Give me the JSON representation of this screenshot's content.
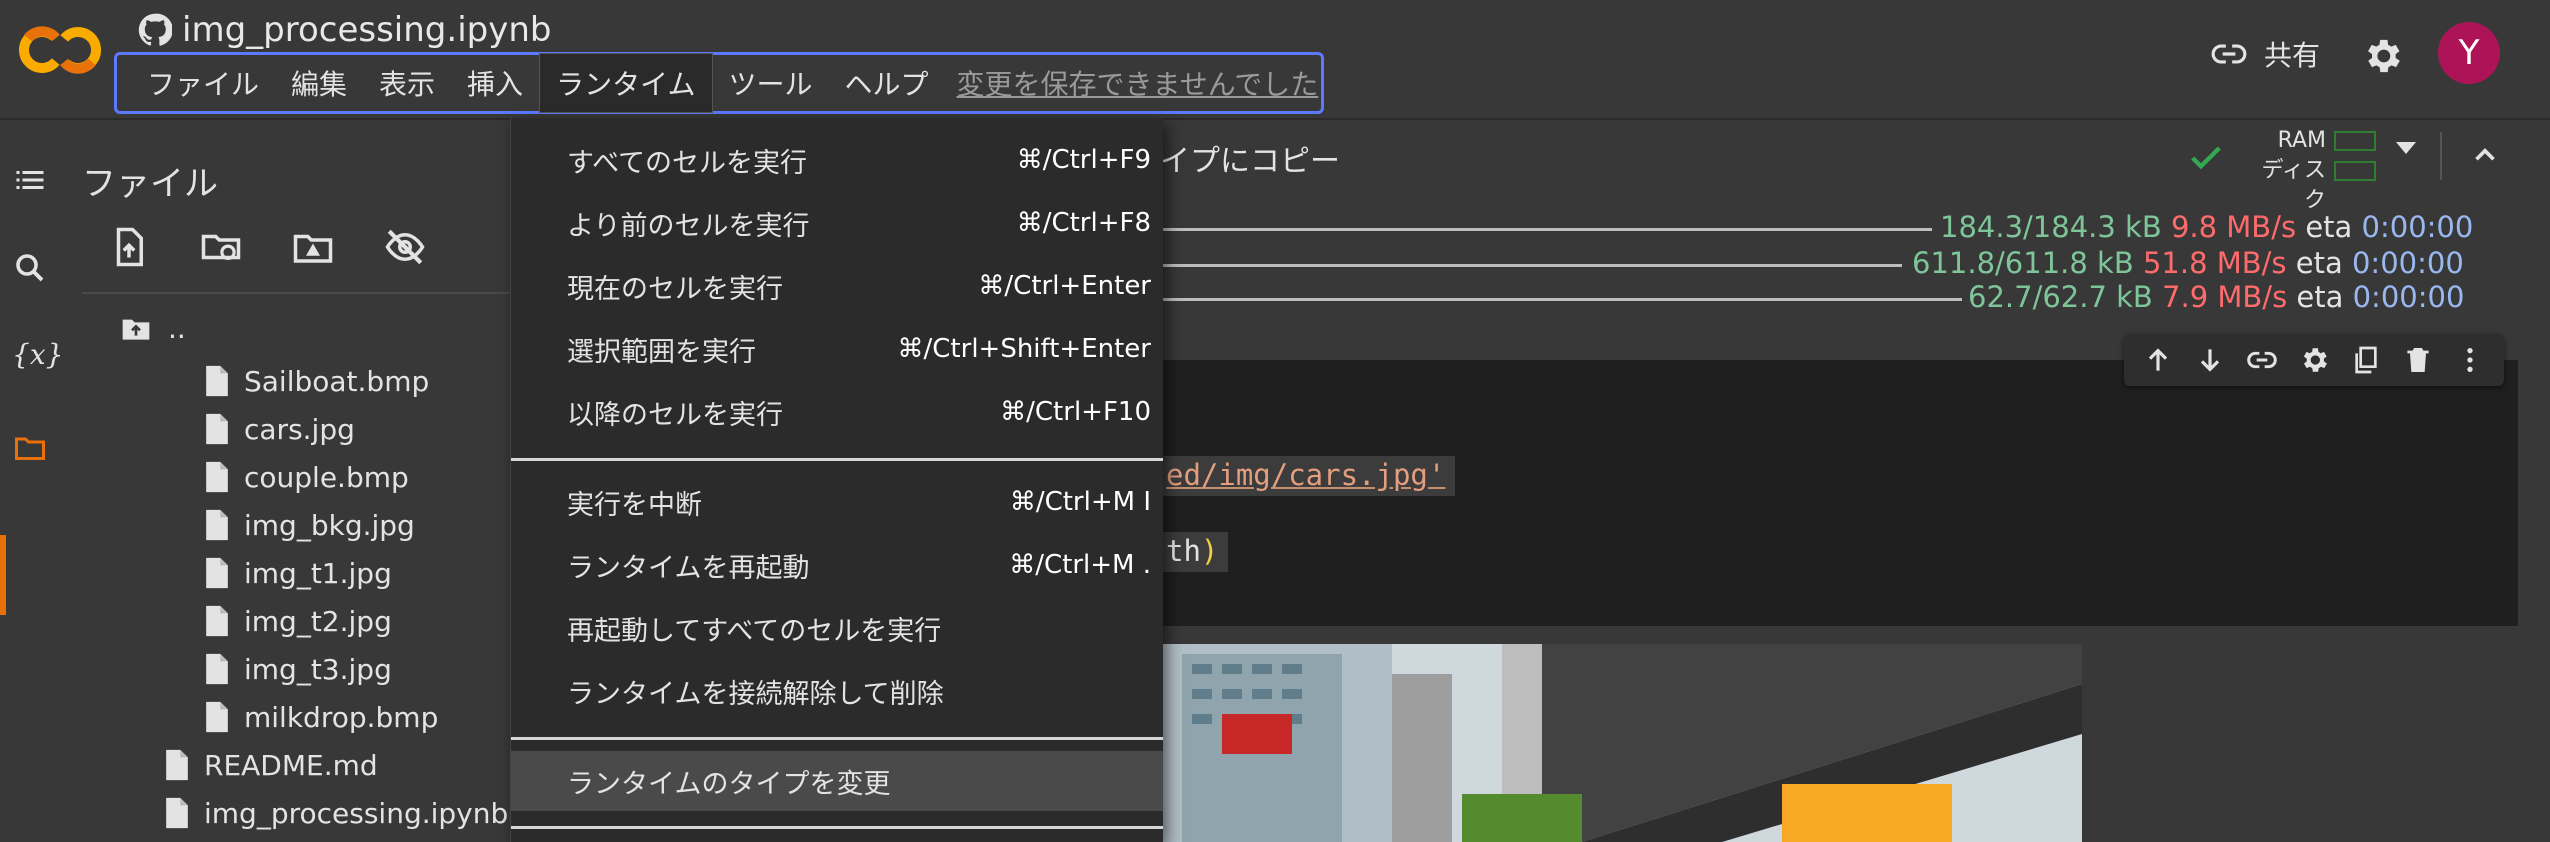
{
  "header": {
    "notebook_title": "img_processing.ipynb",
    "menu": [
      "ファイル",
      "編集",
      "表示",
      "挿入",
      "ランタイム",
      "ツール",
      "ヘルプ"
    ],
    "active_menu_index": 4,
    "save_warning": "変更を保存できませんでした",
    "share_label": "共有",
    "avatar_letter": "Y"
  },
  "file_panel": {
    "title": "ファイル",
    "parent_label": "..",
    "files": [
      "Sailboat.bmp",
      "cars.jpg",
      "couple.bmp",
      "img_bkg.jpg",
      "img_t1.jpg",
      "img_t2.jpg",
      "img_t3.jpg",
      "milkdrop.bmp"
    ],
    "root_files": [
      "README.md",
      "img_processing.ipynb"
    ]
  },
  "main": {
    "copy_text": "イプにコピー",
    "ram_label": "RAM",
    "disk_label": "ディスク",
    "downloads": [
      {
        "size": "184.3/184.3 kB",
        "speed": "9.8 MB/s",
        "eta_label": "eta",
        "eta": "0:00:00"
      },
      {
        "size": "611.8/611.8 kB",
        "speed": "51.8 MB/s",
        "eta_label": "eta",
        "eta": "0:00:00"
      },
      {
        "size": "62.7/62.7 kB",
        "speed": "7.9 MB/s",
        "eta_label": "eta",
        "eta": "0:00:00"
      }
    ],
    "code_line_1": "ed/img/cars.jpg'",
    "code_line_2": "th",
    "code_line_2_paren": ")"
  },
  "runtime_menu": {
    "items": [
      {
        "label": "すべてのセルを実行",
        "shortcut": "⌘/Ctrl+F9"
      },
      {
        "label": "より前のセルを実行",
        "shortcut": "⌘/Ctrl+F8"
      },
      {
        "label": "現在のセルを実行",
        "shortcut": "⌘/Ctrl+Enter"
      },
      {
        "label": "選択範囲を実行",
        "shortcut": "⌘/Ctrl+Shift+Enter"
      },
      {
        "label": "以降のセルを実行",
        "shortcut": "⌘/Ctrl+F10"
      },
      {
        "label": "実行を中断",
        "shortcut": "⌘/Ctrl+M I"
      },
      {
        "label": "ランタイムを再起動",
        "shortcut": "⌘/Ctrl+M ."
      },
      {
        "label": "再起動してすべてのセルを実行",
        "shortcut": ""
      },
      {
        "label": "ランタイムを接続解除して削除",
        "shortcut": ""
      },
      {
        "label": "ランタイムのタイプを変更",
        "shortcut": ""
      }
    ]
  },
  "colors": {
    "accent": "#e8710a",
    "menubar_focus": "#5c79ff",
    "avatar": "#ad1457",
    "progress_green": "#7ec699",
    "progress_red": "#ff6b6b",
    "progress_blue": "#9ab8f0"
  },
  "icons": [
    "colab-logo",
    "github-icon",
    "link-icon",
    "gear-icon",
    "toc-icon",
    "search-icon",
    "variables-icon",
    "folder-icon",
    "upload-icon",
    "refresh-folder-icon",
    "drive-icon",
    "hide-icon",
    "check-icon",
    "caret-down-icon",
    "collapse-icon",
    "arrow-up-icon",
    "arrow-down-icon",
    "cell-link-icon",
    "cell-settings-icon",
    "mirror-cell-icon",
    "delete-icon",
    "more-icon"
  ]
}
